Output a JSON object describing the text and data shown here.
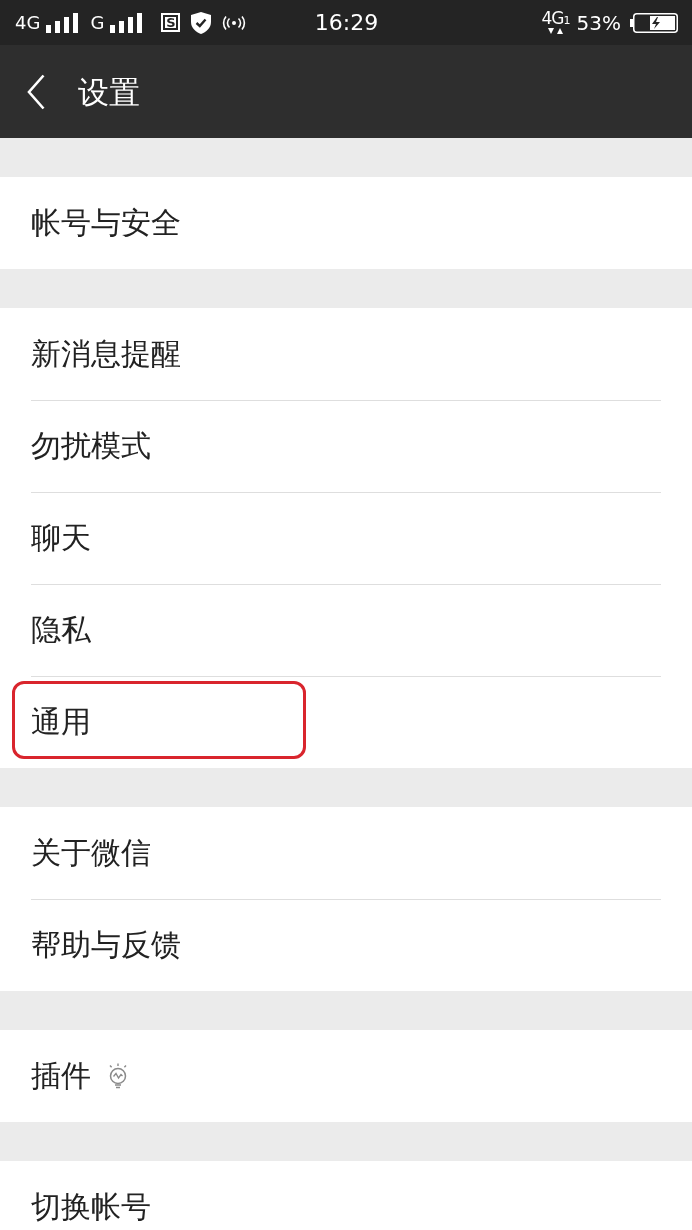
{
  "status_bar": {
    "sim_1_network": "4G",
    "sim_2_network": "G",
    "notification_letter": "S",
    "time": "16:29",
    "data_network": "4G",
    "data_sim": "1",
    "battery_percent": "53%",
    "battery_charging": true
  },
  "header": {
    "title": "设置"
  },
  "groups": [
    {
      "items": [
        {
          "label": "帐号与安全",
          "kind": "plain",
          "highlighted": false
        }
      ]
    },
    {
      "items": [
        {
          "label": "新消息提醒",
          "kind": "plain",
          "highlighted": false
        },
        {
          "label": "勿扰模式",
          "kind": "plain",
          "highlighted": false
        },
        {
          "label": "聊天",
          "kind": "plain",
          "highlighted": false
        },
        {
          "label": "隐私",
          "kind": "plain",
          "highlighted": false
        },
        {
          "label": "通用",
          "kind": "plain",
          "highlighted": true
        }
      ]
    },
    {
      "items": [
        {
          "label": "关于微信",
          "kind": "plain",
          "highlighted": false
        },
        {
          "label": "帮助与反馈",
          "kind": "plain",
          "highlighted": false
        }
      ]
    },
    {
      "items": [
        {
          "label": "插件",
          "kind": "iconed",
          "highlighted": false
        }
      ]
    },
    {
      "items": [
        {
          "label": "切换帐号",
          "kind": "plain",
          "highlighted": false
        }
      ]
    }
  ]
}
